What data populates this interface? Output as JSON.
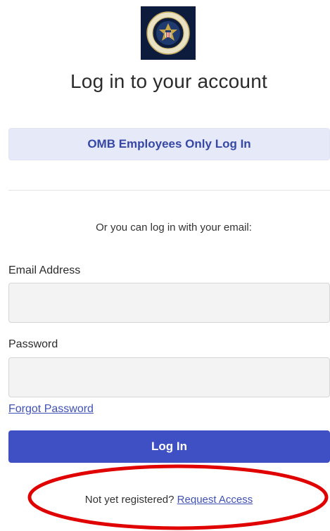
{
  "header": {
    "logo_icon": "omb-presidential-seal-icon",
    "title": "Log in to your account"
  },
  "omb_login": {
    "label": "OMB Employees Only Log In"
  },
  "alt_login": {
    "prompt": "Or you can log in with your email:"
  },
  "form": {
    "email_label": "Email Address",
    "email_value": "",
    "password_label": "Password",
    "password_value": "",
    "forgot_label": "Forgot Password",
    "submit_label": "Log In"
  },
  "footer": {
    "register_prompt": "Not yet registered?",
    "request_access_label": "Request Access"
  },
  "annotation": {
    "shape": "ellipse",
    "color": "#e00000"
  },
  "colors": {
    "primary": "#3f4fc4",
    "primary_light": "#e6e9f7",
    "link": "#3f51b5",
    "seal_background": "#0d1b3d"
  }
}
